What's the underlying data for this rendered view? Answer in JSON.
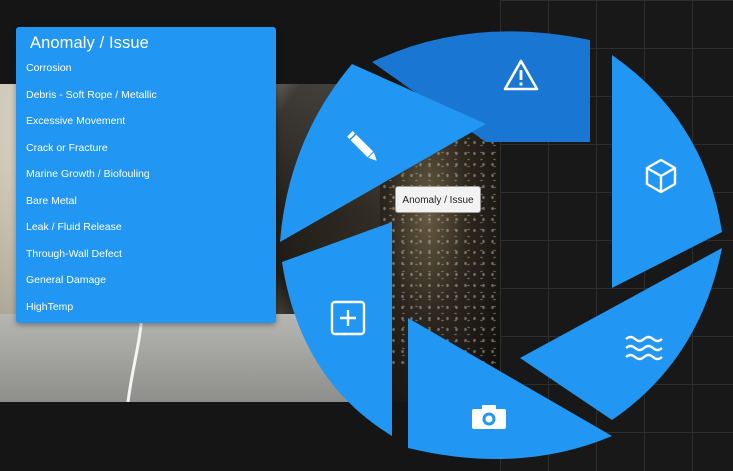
{
  "menu": {
    "title": "Anomaly / Issue",
    "items": [
      {
        "label": "Corrosion"
      },
      {
        "label": "Debris - Soft Rope / Metallic"
      },
      {
        "label": "Excessive Movement"
      },
      {
        "label": "Crack or Fracture"
      },
      {
        "label": "Marine Growth / Biofouling"
      },
      {
        "label": "Bare Metal"
      },
      {
        "label": "Leak / Fluid Release"
      },
      {
        "label": "Through-Wall Defect"
      },
      {
        "label": "General Damage"
      },
      {
        "label": "HighTemp"
      }
    ]
  },
  "radial": {
    "segments": [
      {
        "icon": "warning-icon"
      },
      {
        "icon": "cube-icon"
      },
      {
        "icon": "waves-icon"
      },
      {
        "icon": "camera-icon"
      },
      {
        "icon": "add-square-icon"
      },
      {
        "icon": "pencil-icon"
      }
    ]
  },
  "tooltip": {
    "text": "Anomaly / Issue"
  },
  "colors": {
    "accent": "#2196f3",
    "active": "#1976d2",
    "background": "#151515"
  }
}
